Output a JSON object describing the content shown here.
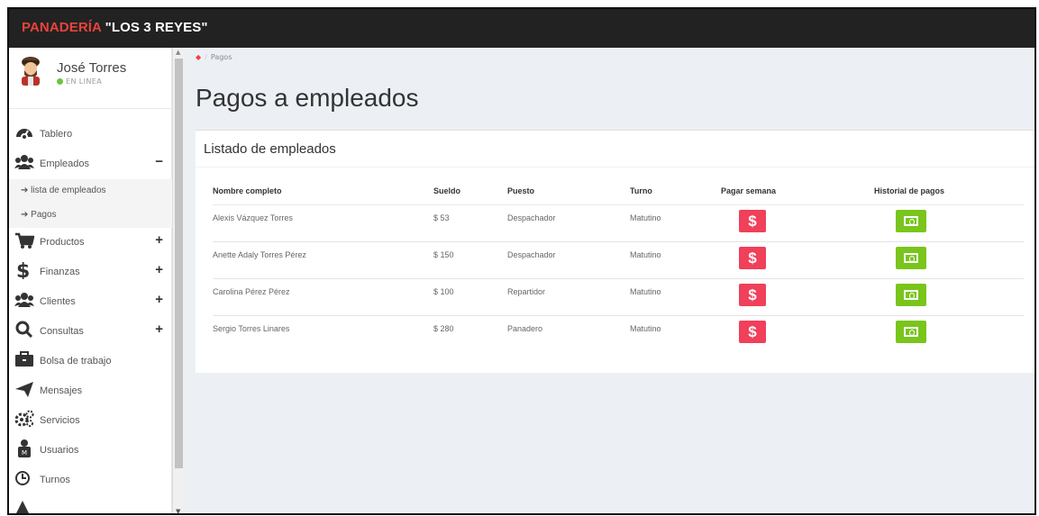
{
  "brand": {
    "part1": "PANADERÍA",
    "part2": " \"LOS 3 REYES\""
  },
  "user": {
    "name": "José Torres",
    "status": "EN LINEA"
  },
  "sidebar": {
    "items": [
      {
        "label": "Tablero",
        "icon": "dashboard-icon",
        "toggle": ""
      },
      {
        "label": "Empleados",
        "icon": "users-icon",
        "toggle": "−"
      },
      {
        "label": "Productos",
        "icon": "cart-icon",
        "toggle": "+"
      },
      {
        "label": "Finanzas",
        "icon": "dollar-icon",
        "toggle": "+"
      },
      {
        "label": "Clientes",
        "icon": "users-icon",
        "toggle": "+"
      },
      {
        "label": "Consultas",
        "icon": "search-icon",
        "toggle": "+"
      },
      {
        "label": "Bolsa de trabajo",
        "icon": "briefcase-icon",
        "toggle": ""
      },
      {
        "label": "Mensajes",
        "icon": "paper-plane-icon",
        "toggle": ""
      },
      {
        "label": "Servicios",
        "icon": "gears-icon",
        "toggle": ""
      },
      {
        "label": "Usuarios",
        "icon": "user-badge-icon",
        "toggle": ""
      },
      {
        "label": "Turnos",
        "icon": "clock-icon",
        "toggle": ""
      }
    ],
    "subitems": [
      {
        "label": "➔ lista de empleados"
      },
      {
        "label": "➔ Pagos"
      }
    ]
  },
  "breadcrumb": {
    "current": "Pagos"
  },
  "page": {
    "title": "Pagos a empleados"
  },
  "box": {
    "title": "Listado de empleados"
  },
  "table": {
    "headers": [
      "Nombre completo",
      "Sueldo",
      "Puesto",
      "Turno",
      "Pagar semana",
      "Historial de pagos"
    ],
    "rows": [
      {
        "name": "Alexis Vázquez Torres",
        "salary": "$ 53",
        "position": "Despachador",
        "shift": "Matutino"
      },
      {
        "name": "Anette Adaly Torres Pérez",
        "salary": "$ 150",
        "position": "Despachador",
        "shift": "Matutino"
      },
      {
        "name": "Carolina Pérez Pérez",
        "salary": "$ 100",
        "position": "Repartidor",
        "shift": "Matutino"
      },
      {
        "name": "Sergio Torres Linares",
        "salary": "$ 280",
        "position": "Panadero",
        "shift": "Matutino"
      }
    ],
    "pay_button_glyph": "$"
  },
  "colors": {
    "brand_red": "#e8443a",
    "pay_button": "#f0405a",
    "history_button": "#79c51c",
    "online": "#6ec43a"
  }
}
